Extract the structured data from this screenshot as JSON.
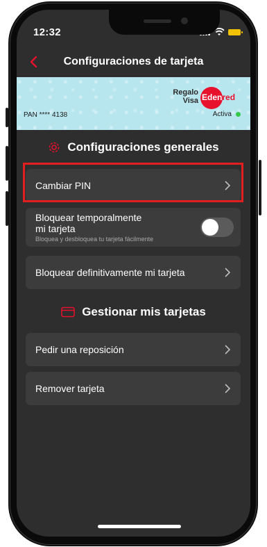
{
  "status_bar": {
    "time": "12:32"
  },
  "nav": {
    "title": "Configuraciones de tarjeta"
  },
  "card": {
    "brand_line1": "Regalo",
    "brand_line2": "Visa",
    "edenred_main": "Eden",
    "edenred_tail": "red",
    "pan": "PAN **** 4138",
    "status": "Activa"
  },
  "section_general": {
    "title": "Configuraciones generales",
    "icon": "gear-icon",
    "items": [
      {
        "label": "Cambiar PIN"
      },
      {
        "label_line1": "Bloquear temporalmente",
        "label_line2": "mi tarjeta",
        "sublabel": "Bloquea y desbloquea tu tarjeta fácilmente",
        "toggle_on": false
      },
      {
        "label": "Bloquear definitivamente mi tarjeta"
      }
    ]
  },
  "section_manage": {
    "title": "Gestionar mis tarjetas",
    "icon": "card-icon",
    "items": [
      {
        "label": "Pedir una reposición"
      },
      {
        "label": "Remover tarjeta"
      }
    ]
  },
  "colors": {
    "accent": "#e8112d",
    "background": "#2e2e2e",
    "row": "#3c3c3c",
    "banner": "#b7e6ef",
    "active": "#37c84a"
  }
}
